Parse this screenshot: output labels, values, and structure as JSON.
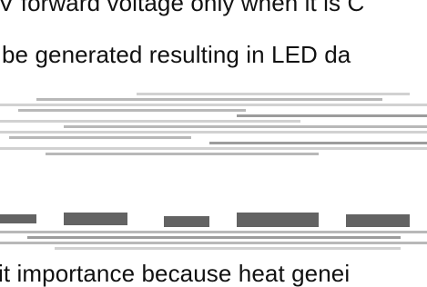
{
  "document": {
    "lines": [
      "V forward voltage only when it is C",
      "be generated resulting in LED da",
      "it importance because heat genei"
    ]
  }
}
